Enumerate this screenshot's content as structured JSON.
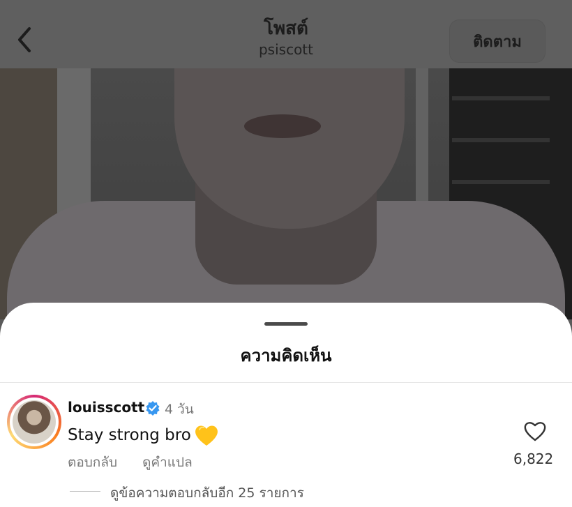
{
  "header": {
    "title": "โพสต์",
    "subtitle": "psiscott",
    "follow_label": "ติดตาม",
    "back_icon": "chevron-left-icon"
  },
  "comments_sheet": {
    "title": "ความคิดเห็น",
    "comment": {
      "username": "louisscott",
      "verified": true,
      "time": "4 วัน",
      "text": "Stay strong bro",
      "emoji": "yellow-heart",
      "reply_label": "ตอบกลับ",
      "translate_label": "ดูคำแปล",
      "like_count": "6,822",
      "more_replies_label": "ดูข้อความตอบกลับอีก 25 รายการ"
    }
  },
  "colors": {
    "verified": "#3797f0",
    "heart": "#ffc21a"
  }
}
